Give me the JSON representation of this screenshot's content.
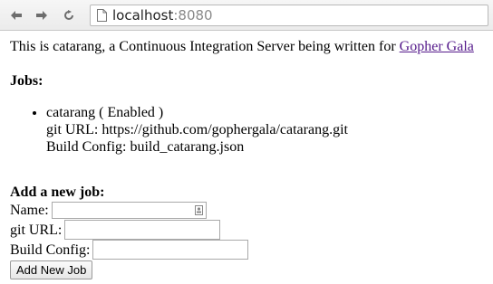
{
  "browser": {
    "url_host": "localhost",
    "url_port": ":8080",
    "icons": {
      "back": "back-arrow-icon",
      "forward": "forward-arrow-icon",
      "reload": "reload-icon",
      "page": "page-icon"
    }
  },
  "intro": {
    "text": "This is catarang, a Continuous Integration Server being written for ",
    "link_text": "Gopher Gala"
  },
  "jobs": {
    "heading": "Jobs:",
    "items": [
      {
        "title": "catarang ( Enabled )",
        "git_url_line": "git URL: https://github.com/gophergala/catarang.git",
        "build_config_line": "Build Config: build_catarang.json"
      }
    ]
  },
  "add_job": {
    "heading": "Add a new job:",
    "name_label": "Name:",
    "name_value": "",
    "git_url_label": "git URL:",
    "git_url_value": "",
    "build_config_label": "Build Config:",
    "build_config_value": "",
    "submit_label": "Add New Job"
  }
}
